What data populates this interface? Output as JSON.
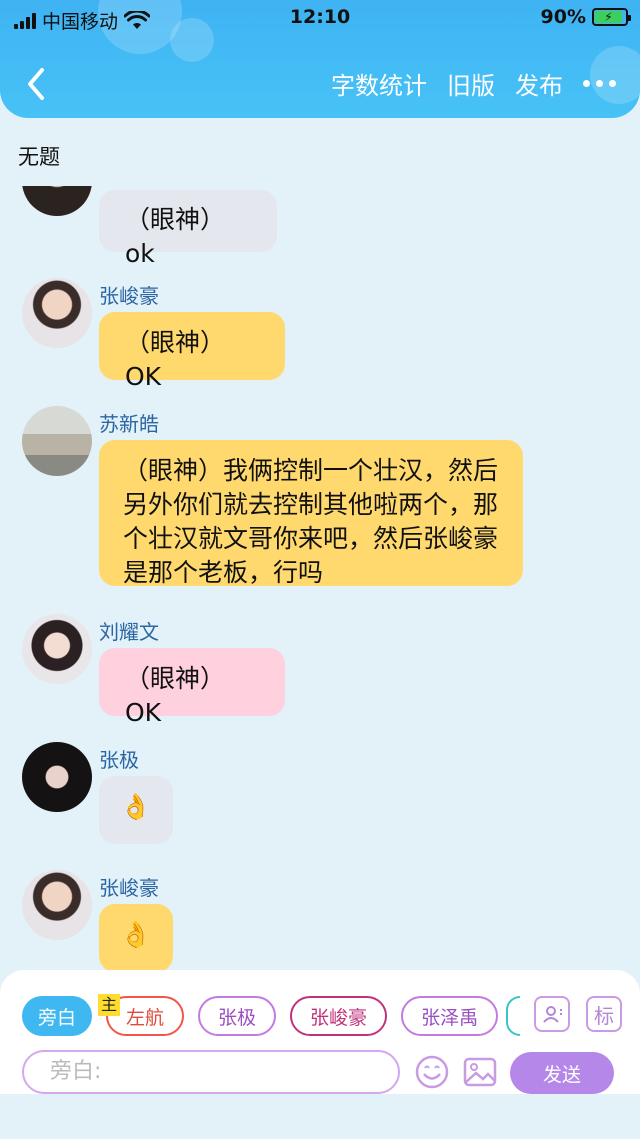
{
  "status_bar": {
    "carrier": "中国移动",
    "time": "12:10",
    "battery": "90%"
  },
  "nav": {
    "word_count": "字数统计",
    "old_version": "旧版",
    "publish": "发布"
  },
  "subtitle": "无题",
  "messages": [
    {
      "speaker": "",
      "text": "（眼神）ok",
      "bubble": "grey"
    },
    {
      "speaker": "张峻豪",
      "text": "（眼神）OK",
      "bubble": "yellow"
    },
    {
      "speaker": "苏新皓",
      "text": "（眼神）我俩控制一个壮汉，然后另外你们就去控制其他啦两个，那个壮汉就文哥你来吧，然后张峻豪是那个老板，行吗",
      "bubble": "yellow"
    },
    {
      "speaker": "刘耀文",
      "text": "（眼神）OK",
      "bubble": "pink"
    },
    {
      "speaker": "张极",
      "text": "👌",
      "bubble": "grey"
    },
    {
      "speaker": "张峻豪",
      "text": "👌",
      "bubble": "yellow"
    }
  ],
  "roles": {
    "chips": [
      "旁白",
      "左航",
      "张极",
      "张峻豪",
      "张泽禹"
    ],
    "owner_badge": "主",
    "tag_button": "标"
  },
  "composer": {
    "placeholder": "旁白:",
    "send": "发送"
  }
}
